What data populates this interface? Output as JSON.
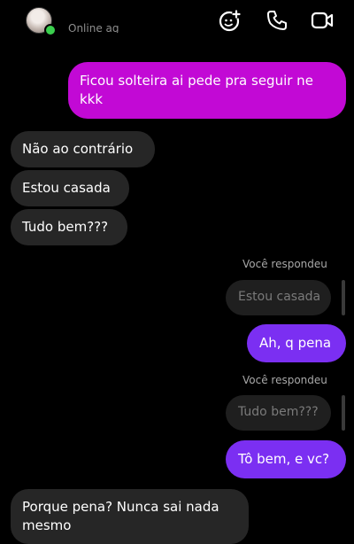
{
  "header": {
    "status": "Online ag",
    "icons": [
      "add-effect-icon",
      "phone-icon",
      "video-camera-icon"
    ]
  },
  "messages": [
    {
      "id": "m1",
      "direction": "outgoing",
      "text_line1": "Ficou solteira ai pede pra seguir ne",
      "text_line2": "kkk"
    },
    {
      "id": "m2",
      "direction": "incoming",
      "text": "Não ao contrário"
    },
    {
      "id": "m3",
      "direction": "incoming",
      "text": "Estou casada"
    },
    {
      "id": "m4",
      "direction": "incoming",
      "text": "Tudo bem???"
    },
    {
      "id": "r1",
      "reply_label": "Você respondeu",
      "quoted": "Estou casada",
      "text": "Ah, q pena"
    },
    {
      "id": "r2",
      "reply_label": "Você respondeu",
      "quoted": "Tudo bem???",
      "text": "Tô bem, e vc?"
    },
    {
      "id": "m5",
      "direction": "incoming",
      "text_line1": "Porque pena? Nunca sai nada",
      "text_line2": "mesmo"
    }
  ],
  "colors": {
    "outgoing_pink": "#c209d5",
    "outgoing_purple": "#7b2ff2",
    "incoming": "#262626",
    "online": "#3bcf4e"
  }
}
